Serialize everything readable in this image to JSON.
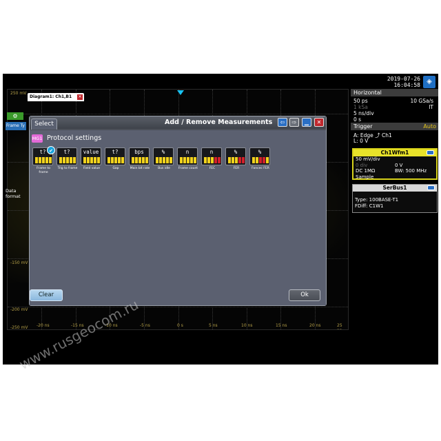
{
  "topbar": {
    "date": "2019-07-26",
    "time": "16:04:58",
    "logo_icon": "rs-logo-icon"
  },
  "waveform": {
    "y_labels": [
      "250 mV",
      "-150 mV",
      "-200 mV",
      "-250 mV"
    ],
    "x_labels": [
      "-20 ns",
      "-15 ns",
      "-10 ns",
      "-5 ns",
      "0 s",
      "5 ns",
      "10 ns",
      "15 ns",
      "20 ns",
      "25 ns"
    ],
    "diagram_tab": "Diagram1: Ch1,B1"
  },
  "left_panel": {
    "frame_tab": "Frame Ty",
    "data_format": "Data format"
  },
  "horizontal": {
    "title": "Horizontal",
    "rows": [
      {
        "l": "50 ps",
        "r": "10 GSa/s"
      },
      {
        "l": "1 kSa",
        "r": "IT"
      },
      {
        "l": "5 ns/div",
        "r": ""
      },
      {
        "l": "0 s",
        "r": ""
      }
    ]
  },
  "trigger": {
    "title": "Trigger",
    "mode": "Auto",
    "row1": "A:  Edge  ⤴ Ch1",
    "row2": "L:  0 V"
  },
  "ch1": {
    "title": "Ch1Wfm1",
    "scale": "50 mV/div",
    "offset_l": "0 div",
    "offset_r": "0 V",
    "coupling": "DC 1MΩ",
    "bw": "BW: 500 MHz",
    "acq": "Sample"
  },
  "serbus": {
    "title": "SerBus1",
    "type": "Type: 100BASE-T1",
    "src": "FDiff: C1W1"
  },
  "dialog": {
    "tab": "Select",
    "title": "Add / Remove Measurements",
    "group_badge": "MG1",
    "group_title": "Protocol settings",
    "clear": "Clear",
    "ok": "Ok",
    "measurements": [
      {
        "sym": "t?",
        "label": "Frame to frame",
        "checked": true
      },
      {
        "sym": "t?",
        "label": "Trig to frame",
        "checked": false
      },
      {
        "sym": "value",
        "label": "Field value",
        "checked": false
      },
      {
        "sym": "t?",
        "label": "Gap",
        "checked": false
      },
      {
        "sym": "bps",
        "label": "Main bit rate",
        "checked": false
      },
      {
        "sym": "%",
        "label": "Bus idle",
        "checked": false
      },
      {
        "sym": "n",
        "label": "Frame count",
        "checked": false
      },
      {
        "sym": "n",
        "label": "FEC",
        "checked": false
      },
      {
        "sym": "%",
        "label": "FER",
        "checked": false
      },
      {
        "sym": "%",
        "label": "Foncec FER",
        "checked": false
      }
    ]
  },
  "watermark": "www.rusgeocom.ru"
}
